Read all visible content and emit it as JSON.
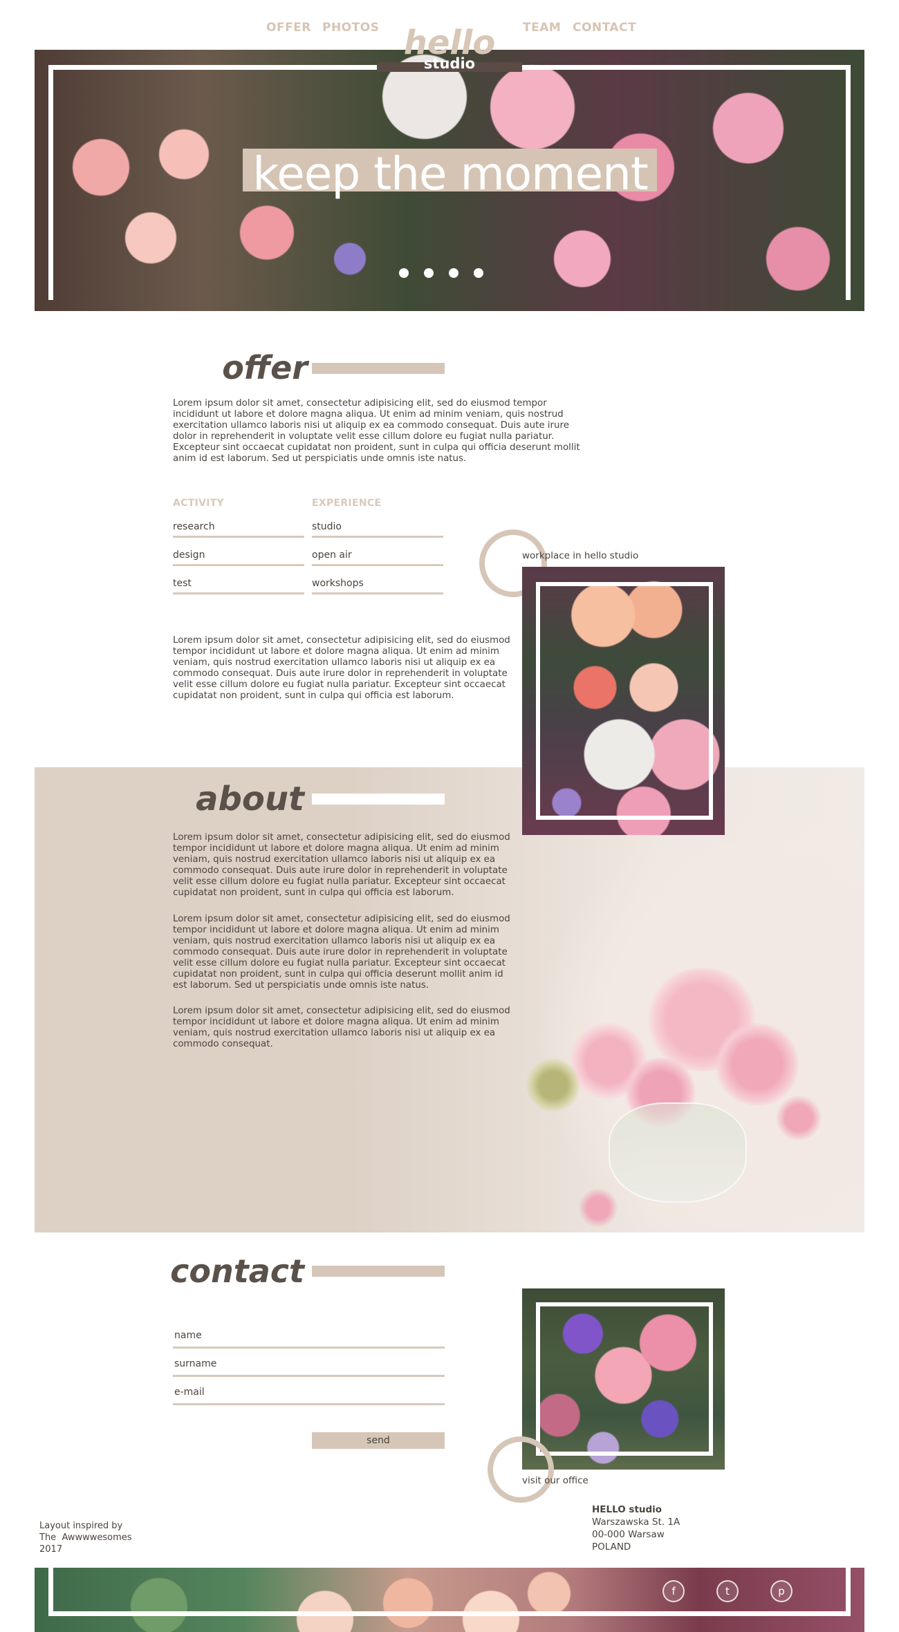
{
  "nav": {
    "offer": "OFFER",
    "photos": "PHOTOS",
    "team": "TEAM",
    "contact": "CONTACT"
  },
  "logo": {
    "hello": "hello",
    "studio": "studio"
  },
  "hero": {
    "title": "keep the moment",
    "slide_count": 4
  },
  "offer": {
    "title": "offer",
    "intro": "Lorem ipsum dolor sit amet, consectetur adipisicing elit, sed do eiusmod tempor incididunt ut labore et dolore magna aliqua. Ut enim ad minim veniam, quis nostrud exercitation ullamco laboris nisi ut aliquip ex ea commodo consequat. Duis aute irure dolor in reprehenderit in voluptate velit esse cillum dolore eu fugiat nulla pariatur. Excepteur sint occaecat cupidatat non proident, sunt in culpa qui officia deserunt mollit anim id est laborum. Sed ut perspiciatis unde omnis iste natus.",
    "activity_header": "ACTIVITY",
    "experience_header": "EXPERIENCE",
    "activity": [
      "research",
      "design",
      "test"
    ],
    "experience": [
      "studio",
      "open air",
      "workshops"
    ],
    "body": "Lorem ipsum dolor sit amet, consectetur adipisicing elit, sed do eiusmod tempor incididunt ut labore et dolore magna aliqua. Ut enim ad minim veniam, quis nostrud exercitation ullamco laboris nisi ut aliquip ex ea commodo consequat. Duis aute irure dolor in reprehenderit in voluptate velit esse cillum dolore eu fugiat nulla pariatur. Excepteur sint occaecat cupidatat non proident, sunt in culpa qui officia est laborum.",
    "photo_caption": "workplace in hello studio"
  },
  "about": {
    "title": "about",
    "p1": "Lorem ipsum dolor sit amet, consectetur adipisicing elit, sed do eiusmod tempor incididunt ut labore et dolore magna aliqua. Ut enim ad minim veniam, quis nostrud exercitation ullamco laboris nisi ut aliquip ex ea commodo consequat. Duis aute irure dolor in reprehenderit in voluptate velit esse cillum dolore eu fugiat nulla pariatur. Excepteur sint occaecat cupidatat non proident, sunt in culpa qui officia est laborum.",
    "p2": "Lorem ipsum dolor sit amet, consectetur adipisicing elit, sed do eiusmod tempor incididunt ut labore et dolore magna aliqua. Ut enim ad minim veniam, quis nostrud exercitation ullamco laboris nisi ut aliquip ex ea commodo consequat. Duis aute irure dolor in reprehenderit in voluptate velit esse cillum dolore eu fugiat nulla pariatur. Excepteur sint occaecat cupidatat non proident, sunt in culpa qui officia deserunt mollit anim id est laborum. Sed ut perspiciatis unde omnis iste natus.",
    "p3": "Lorem ipsum dolor sit amet, consectetur adipisicing elit, sed do eiusmod tempor incididunt ut labore et dolore magna aliqua. Ut enim ad minim veniam, quis nostrud exercitation ullamco laboris nisi ut aliquip ex ea commodo consequat."
  },
  "contact": {
    "title": "contact",
    "name_label": "name",
    "surname_label": "surname",
    "email_label": "e-mail",
    "send": "send",
    "photo_caption": "visit our office"
  },
  "footer": {
    "credit_line1": "Layout inspired by",
    "credit_line2": "The  Awwwwesomes",
    "credit_line3": "2017",
    "company": "HELLO studio",
    "street": "Warszawska St. 1A",
    "city": "00-000 Warsaw",
    "country": "POLAND",
    "social": [
      {
        "icon": "facebook-icon",
        "glyph": "f"
      },
      {
        "icon": "twitter-icon",
        "glyph": "t"
      },
      {
        "icon": "pinterest-icon",
        "glyph": "p"
      }
    ]
  },
  "colors": {
    "accent": "#d5c6b8",
    "nav": "#d7c4b4",
    "title": "#5a514a",
    "text": "#4a433d"
  }
}
